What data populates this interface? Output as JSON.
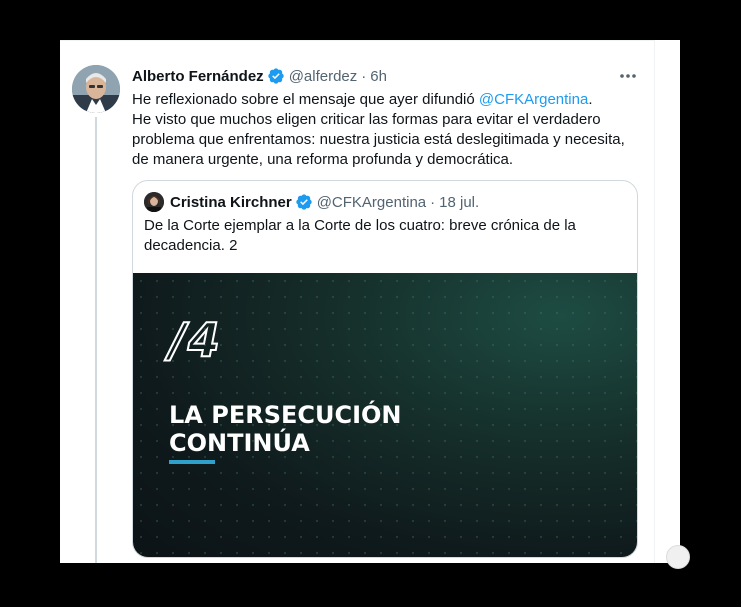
{
  "tweet": {
    "author_name": "Alberto Fernández",
    "author_handle": "@alferdez",
    "time": "6h",
    "separator": "·",
    "text_before_mention": "He reflexionado sobre el mensaje que ayer difundió ",
    "mention": "@CFKArgentina",
    "text_after_mention": ".",
    "text_rest": "He visto que muchos eligen criticar las formas para evitar el verdadero problema que enfrentamos: nuestra justicia está deslegitimada y necesita, de manera urgente, una reforma profunda y democrática."
  },
  "quoted_tweet": {
    "author_name": "Cristina Kirchner",
    "author_handle": "@CFKArgentina",
    "separator": "·",
    "date": "18 jul.",
    "text": "De la Corte ejemplar a la Corte de los cuatro: breve crónica de la decadencia. 2",
    "media": {
      "number": "/4",
      "title": "LA PERSECUCIÓN CONTINÚA"
    }
  },
  "icons": {
    "verified": "verified-badge-icon",
    "more": "more-options-icon"
  },
  "colors": {
    "accent": "#1d9bf0",
    "text": "#0f1419",
    "secondary": "#536471",
    "media_underline": "#2ea0c9"
  }
}
